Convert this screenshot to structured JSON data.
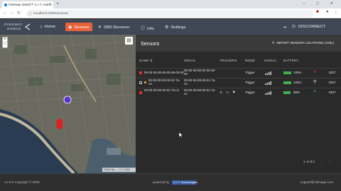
{
  "browser": {
    "tab_title": "Parkway Shield™ C.I.T. Admin",
    "new_tab_glyph": "+",
    "window_controls": "–  ▢  ✕",
    "url": "localhost:3000/sensors",
    "nav_glyphs": [
      "←",
      "→",
      "↻"
    ]
  },
  "app": {
    "logo_line1": "PARKWAY",
    "logo_line2": "SHIELD",
    "nav": [
      {
        "label": "Home",
        "icon": "home-icon",
        "glyph": "⌂"
      },
      {
        "label": "Sensors",
        "icon": "sensors-icon",
        "glyph": "◉"
      },
      {
        "label": "SBD Receiver",
        "icon": "receiver-icon",
        "glyph": "✈"
      },
      {
        "label": "Info",
        "icon": "info-icon",
        "glyph": "ⓘ"
      },
      {
        "label": "Settings",
        "icon": "gear-icon",
        "glyph": "⚙"
      }
    ],
    "disconnect_label": "DISCONNECT",
    "colors": {
      "header": "#3f4854",
      "active": "#e8623a",
      "battery": "#3fb04a",
      "alert": "#e03030"
    }
  },
  "map": {
    "attribution": "©2020 Tile, ..., C.I.T. 1000",
    "zoom_in": "+",
    "zoom_out": "−"
  },
  "sensors": {
    "title": "Sensors",
    "import_label": "IMPORT SENSOR LOCATIONS (.KML)",
    "columns": [
      "NAME",
      "SERIAL",
      "TRIGGERS",
      "MODE",
      "SIGNAL",
      "BATTERY"
    ],
    "sort_glyph": "⇅",
    "rows": [
      {
        "name": "00-00-00-00-00-00-06-00-00",
        "serial": "00-00-00-00-00-00-00-00",
        "mode": "Trigger",
        "battery": "100%",
        "edit": "EDIT",
        "checked": true,
        "pin_color": "#e03030"
      },
      {
        "name": "00-00-00-00-00-01-7a-c0",
        "serial": "00-00-00-00-00-01-7a-c0",
        "mode": "Trigger",
        "battery": "100%",
        "edit": "EDIT",
        "checked": false,
        "pin_color": "#ffffff"
      },
      {
        "name": "00-00-00-00-00-01-7a-c2",
        "serial": "00-00-00-00-00-01-7a-c2",
        "mode": "Trigger",
        "battery": "88%",
        "edit": "EDIT",
        "checked": true,
        "pin_color": "#3fb04a"
      }
    ],
    "row2_trigger_icons": "♙ ▭ ⚑",
    "pagination": "1–3 of 3"
  },
  "footer": {
    "version": "v.2.0.0  Copyright © 2020",
    "powered_by": "powered by",
    "brand": "C.I.T. Technologies",
    "support": "support@citimage.com"
  }
}
